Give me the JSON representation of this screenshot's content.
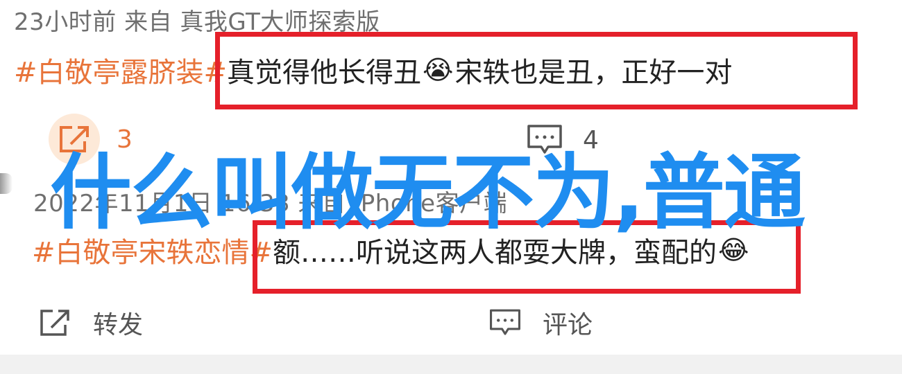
{
  "post1": {
    "meta": "23小时前 来自 真我GT大师探索版",
    "hashtag": "#白敬亭露脐装#",
    "text_before_emoji": "真觉得他长得丑",
    "emoji": "😭",
    "text_after_emoji": "宋轶也是丑，正好一对",
    "share_count": "3",
    "comment_count": "4"
  },
  "post2": {
    "meta": "2022年11月1日 16:33 来自 iPhone客户端",
    "hashtag": "#白敬亭宋轶恋情#",
    "text_before_emoji": "额……听说这两人都耍大牌，蛮配的",
    "emoji": "😂",
    "share_label": "转发",
    "comment_label": "评论"
  },
  "overlay_title": "什么叫做无不为,普通",
  "colors": {
    "hashtag": "#e8743a",
    "highlight_border": "#e5202a",
    "overlay_text": "#1f8df0",
    "meta_text": "#6f6f6f"
  },
  "icons": [
    "share-icon",
    "comment-icon"
  ]
}
